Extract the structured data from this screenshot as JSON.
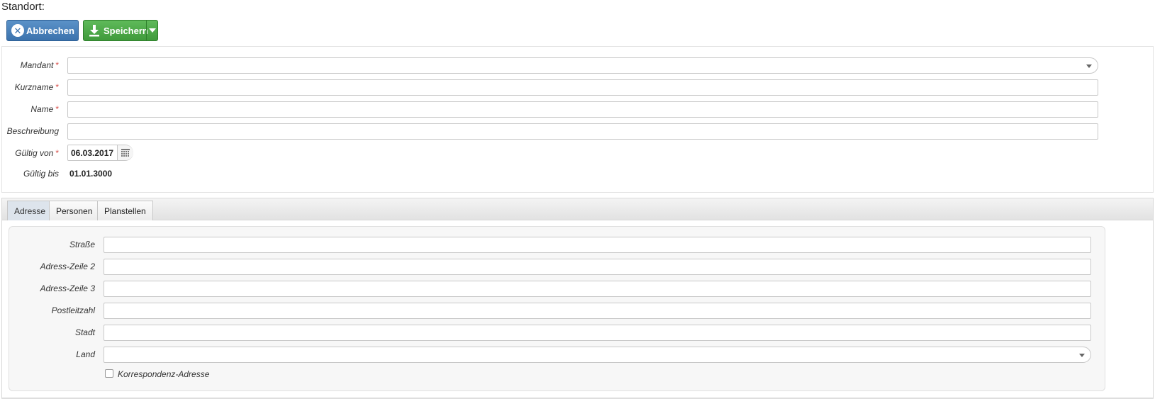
{
  "page": {
    "title": "Standort:"
  },
  "toolbar": {
    "cancel_label": "Abbrechen",
    "save_label": "Speichern"
  },
  "form": {
    "mandant": {
      "label": "Mandant",
      "value": ""
    },
    "kurzname": {
      "label": "Kurzname",
      "value": ""
    },
    "name": {
      "label": "Name",
      "value": ""
    },
    "beschreibung": {
      "label": "Beschreibung",
      "value": ""
    },
    "gueltig_von": {
      "label": "Gültig von",
      "value": "06.03.2017"
    },
    "gueltig_bis": {
      "label": "Gültig bis",
      "value": "01.01.3000"
    },
    "required_marker": "*"
  },
  "tabs": [
    {
      "label": "Adresse",
      "active": true
    },
    {
      "label": "Personen",
      "active": false
    },
    {
      "label": "Planstellen",
      "active": false
    }
  ],
  "address": {
    "strasse": {
      "label": "Straße",
      "value": ""
    },
    "zeile2": {
      "label": "Adress-Zeile 2",
      "value": ""
    },
    "zeile3": {
      "label": "Adress-Zeile 3",
      "value": ""
    },
    "plz": {
      "label": "Postleitzahl",
      "value": ""
    },
    "stadt": {
      "label": "Stadt",
      "value": ""
    },
    "land": {
      "label": "Land",
      "value": ""
    },
    "korrespondenz": {
      "label": "Korrespondenz-Adresse",
      "checked": false
    }
  },
  "colors": {
    "cancel_button": "#3b72ad",
    "save_button": "#3f9a3b",
    "required_marker": "#d9534f"
  },
  "icons": {
    "cancel": "close-circle-icon",
    "save": "download-icon",
    "save_menu": "chevron-down-icon",
    "date_picker": "calendar-icon",
    "combo_caret": "chevron-down-icon"
  }
}
